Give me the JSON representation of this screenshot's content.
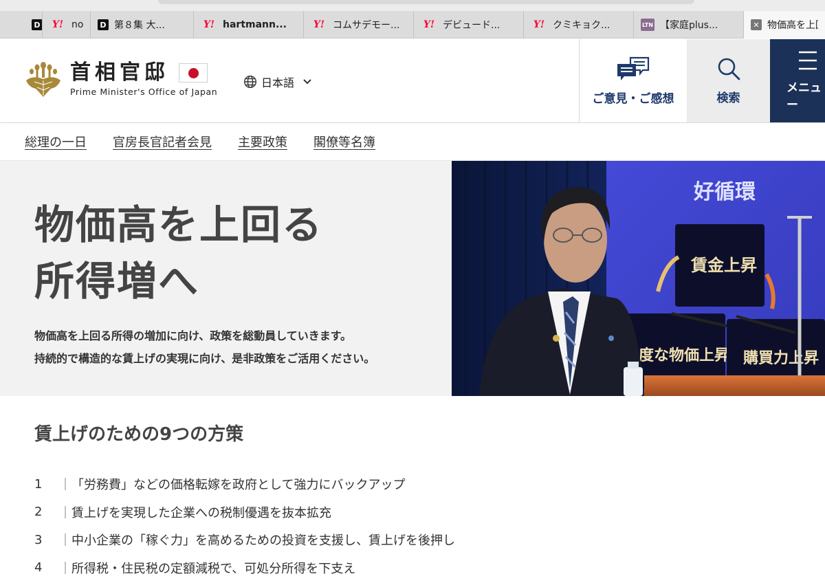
{
  "browser": {
    "tabs": [
      {
        "favicon": "yahoo-favicon",
        "label": "no"
      },
      {
        "favicon": "d-favicon",
        "label": "第８集 大..."
      },
      {
        "favicon": "yahoo-favicon",
        "label": "hartmann..."
      },
      {
        "favicon": "yahoo-favicon",
        "label": "コムサデモー..."
      },
      {
        "favicon": "yahoo-favicon",
        "label": "デビュード..."
      },
      {
        "favicon": "yahoo-favicon",
        "label": "クミキョク..."
      },
      {
        "favicon": "ltn-favicon",
        "label": "【家庭plus..."
      },
      {
        "favicon": "close-icon",
        "label": "物価高を上回"
      }
    ],
    "favicon_glyphs": {
      "yahoo": "Y!",
      "d": "D",
      "ltn": "LTN",
      "close": "✕"
    }
  },
  "header": {
    "logo_jp": "首相官邸",
    "logo_en": "Prime Minister's Office of Japan",
    "language": "日本語",
    "opinion_label": "ご意見・ご感想",
    "search_label": "検索",
    "menu_label": "メニュー"
  },
  "nav": {
    "items": [
      "総理の一日",
      "官房長官記者会見",
      "主要政策",
      "閣僚等名簿"
    ]
  },
  "hero": {
    "title_line1": "物価高を上回る",
    "title_line2": "所得増へ",
    "lead_line1": "物価高を上回る所得の増加に向け、政策を総動員していきます。",
    "lead_line2": "持続的で構造的な賃上げの実現に向け、是非政策をご活用ください。",
    "photo_texts": {
      "header": "好循環",
      "box1": "賃金上昇",
      "box2": "適度な物価上昇",
      "box3": "購買力上昇"
    }
  },
  "measures": {
    "title": "賃上げのための9つの方策",
    "separator": "｜",
    "items": [
      {
        "num": "1",
        "text": "「労務費」などの価格転嫁を政府として強力にバックアップ"
      },
      {
        "num": "2",
        "text": "賃上げを実現した企業への税制優遇を抜本拡充"
      },
      {
        "num": "3",
        "text": "中小企業の「稼ぐ力」を高めるための投資を支援し、賃上げを後押し"
      },
      {
        "num": "4",
        "text": "所得税・住民税の定額減税で、可処分所得を下支え"
      }
    ]
  },
  "colors": {
    "navy": "#1b3157",
    "accent_text": "#1d3a6b",
    "flag_red": "#c8102e",
    "hero_bg": "#f2f2f2"
  }
}
